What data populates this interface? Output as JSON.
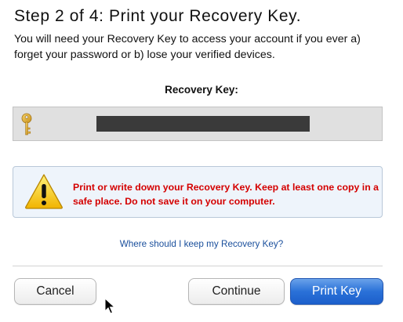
{
  "header": {
    "title": "Step 2 of 4: Print your Recovery Key.",
    "description": "You will need your Recovery Key to access your account if you ever a) forget your password or b) lose your verified devices."
  },
  "recovery_key": {
    "label": "Recovery Key:",
    "icon": "key-icon",
    "value_redacted": true
  },
  "warning": {
    "icon": "warning-icon",
    "text": "Print or write down your Recovery Key. Keep at least one copy in a safe place. Do not save it on your computer.",
    "color": "#d40000"
  },
  "help_link": {
    "label": "Where should I keep my Recovery Key?",
    "color": "#1a4f9c"
  },
  "buttons": {
    "cancel_label": "Cancel",
    "continue_label": "Continue",
    "print_label": "Print Key"
  },
  "colors": {
    "primary_button": "#2a71d8",
    "key_field_background": "#e0e0e0",
    "warning_background": "#eef4fb"
  }
}
